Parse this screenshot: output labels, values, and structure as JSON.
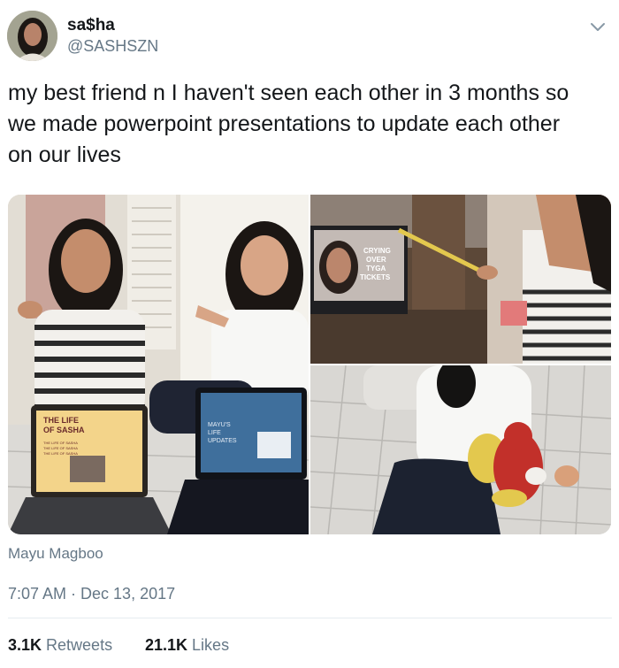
{
  "user": {
    "display_name": "sa$ha",
    "handle": "@SASHSZN",
    "avatar_icon": "profile-photo"
  },
  "tweet": {
    "text": "my best friend n I haven't seen each other in 3 months so\nwe made powerpoint presentations to update each other\non our lives"
  },
  "media": {
    "photo_left": {
      "screen1_title": "THE LIFE\nOF SASHA",
      "screen1_repeat": "THE LIFE OF SASHA",
      "screen2_text": "MAYU'S\nLIFE\nUPDATES"
    },
    "photo_top_right": {
      "screen_text": "CRYING\nOVER\nTYGA\nTICKETS"
    }
  },
  "caption": "Mayu Magboo",
  "timestamp": "7:07 AM · Dec 13, 2017",
  "stats": {
    "retweets_count": "3.1K",
    "retweets_label": "Retweets",
    "likes_count": "21.1K",
    "likes_label": "Likes"
  },
  "colors": {
    "primary_text": "#14171a",
    "secondary_text": "#657786",
    "divider": "#e6ecf0"
  }
}
